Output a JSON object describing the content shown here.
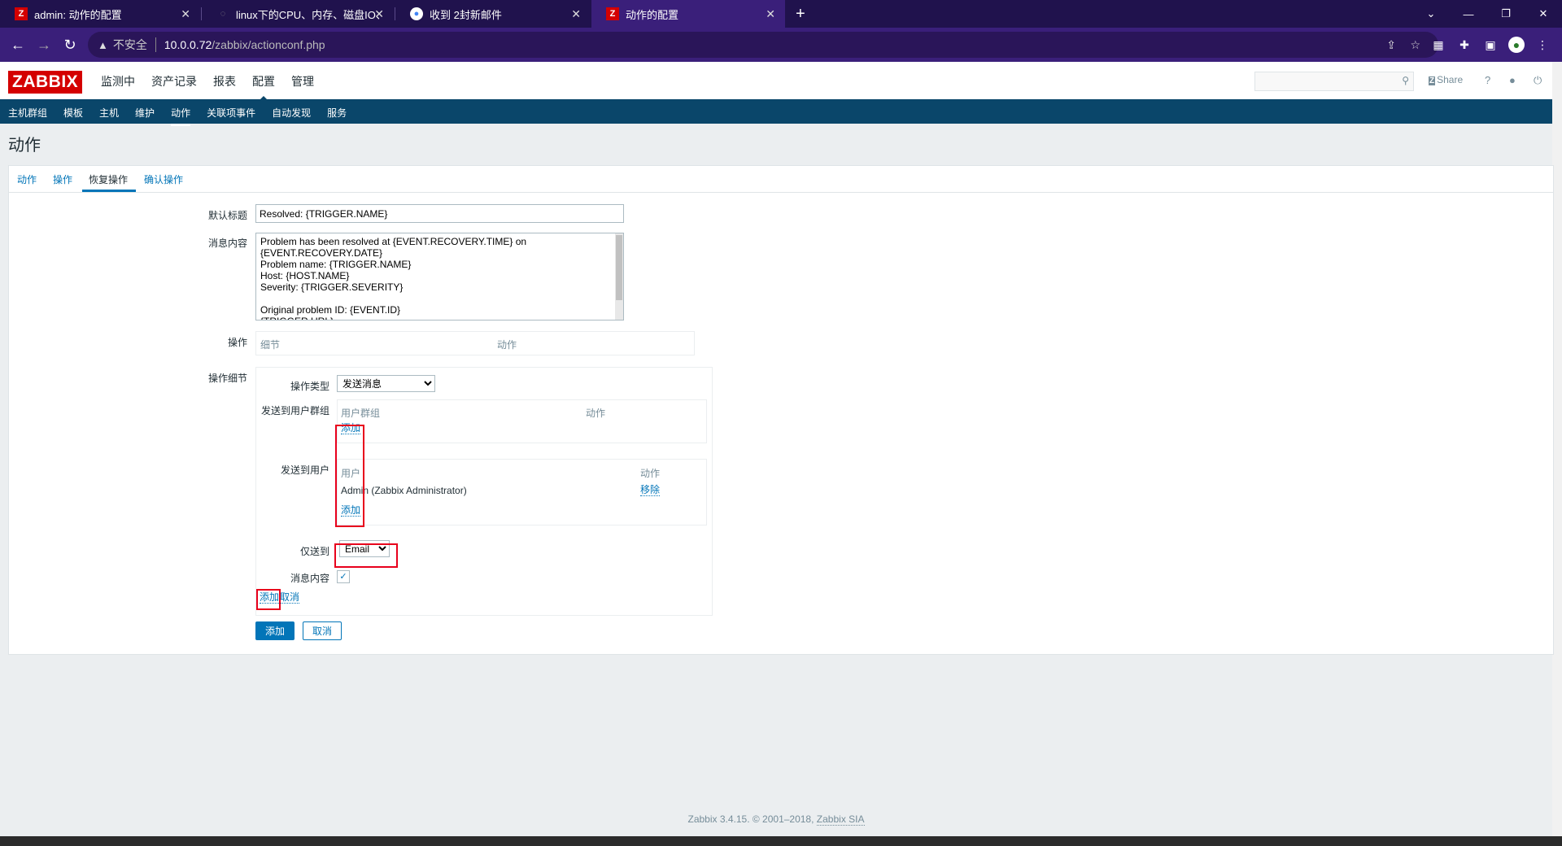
{
  "browser": {
    "tabs": [
      {
        "icon": "zabbix-favicon",
        "favicon_letter": "Z",
        "favicon_color": "#d40000",
        "title": "admin: 动作的配置"
      },
      {
        "icon": "github-favicon",
        "favicon_letter": "",
        "favicon_color": "",
        "title": "linux下的CPU、内存、磁盘IO、"
      },
      {
        "icon": "mail-favicon",
        "favicon_letter": "",
        "favicon_color": "#4285f4",
        "title": "收到 2封新邮件"
      },
      {
        "icon": "zabbix-favicon",
        "favicon_letter": "Z",
        "favicon_color": "#d40000",
        "title": "动作的配置"
      }
    ],
    "new_tab": "+",
    "insecure_label": "不安全",
    "url_host": "10.0.0.72",
    "url_path": "/zabbix/actionconf.php"
  },
  "header": {
    "logo": "ZABBIX",
    "menu": [
      "监测中",
      "资产记录",
      "报表",
      "配置",
      "管理"
    ],
    "selected_menu": "配置",
    "share": "Share",
    "share_mark": "Z",
    "help": "?"
  },
  "submenu": [
    "主机群组",
    "模板",
    "主机",
    "维护",
    "动作",
    "关联项事件",
    "自动发现",
    "服务"
  ],
  "page": {
    "title": "动作",
    "tabs": [
      "动作",
      "操作",
      "恢复操作",
      "确认操作"
    ],
    "active_tab": "恢复操作"
  },
  "form": {
    "default_subject_label": "默认标题",
    "default_subject_value": "Resolved: {TRIGGER.NAME}",
    "message_label": "消息内容",
    "message_value": "Problem has been resolved at {EVENT.RECOVERY.TIME} on {EVENT.RECOVERY.DATE}\nProblem name: {TRIGGER.NAME}\nHost: {HOST.NAME}\nSeverity: {TRIGGER.SEVERITY}\n\nOriginal problem ID: {EVENT.ID}\n{TRIGGER.URL}",
    "operations_label": "操作",
    "operations_col_details": "细节",
    "operations_col_action": "动作",
    "op_details_label": "操作细节",
    "op_type_label": "操作类型",
    "op_type_value": "发送消息",
    "send_group_label": "发送到用户群组",
    "group_col_group": "用户群组",
    "group_col_action": "动作",
    "group_add": "添加",
    "send_user_label": "发送到用户",
    "user_col_user": "用户",
    "user_col_action": "动作",
    "user_row_name": "Admin (Zabbix Administrator)",
    "user_row_remove": "移除",
    "user_add": "添加",
    "send_only_label": "仅送到",
    "send_only_value": "Email",
    "default_msg_label": "消息内容",
    "default_msg_checked": true,
    "inner_add": "添加",
    "inner_cancel": "取消",
    "submit_add": "添加",
    "submit_cancel": "取消"
  },
  "footer": {
    "text": "Zabbix 3.4.15. © 2001–2018,",
    "link": "Zabbix SIA"
  },
  "colors": {
    "highlight": "#e8001c",
    "brand_red": "#d40000",
    "nav_blue": "#0a466a",
    "link_blue": "#0275b8"
  }
}
